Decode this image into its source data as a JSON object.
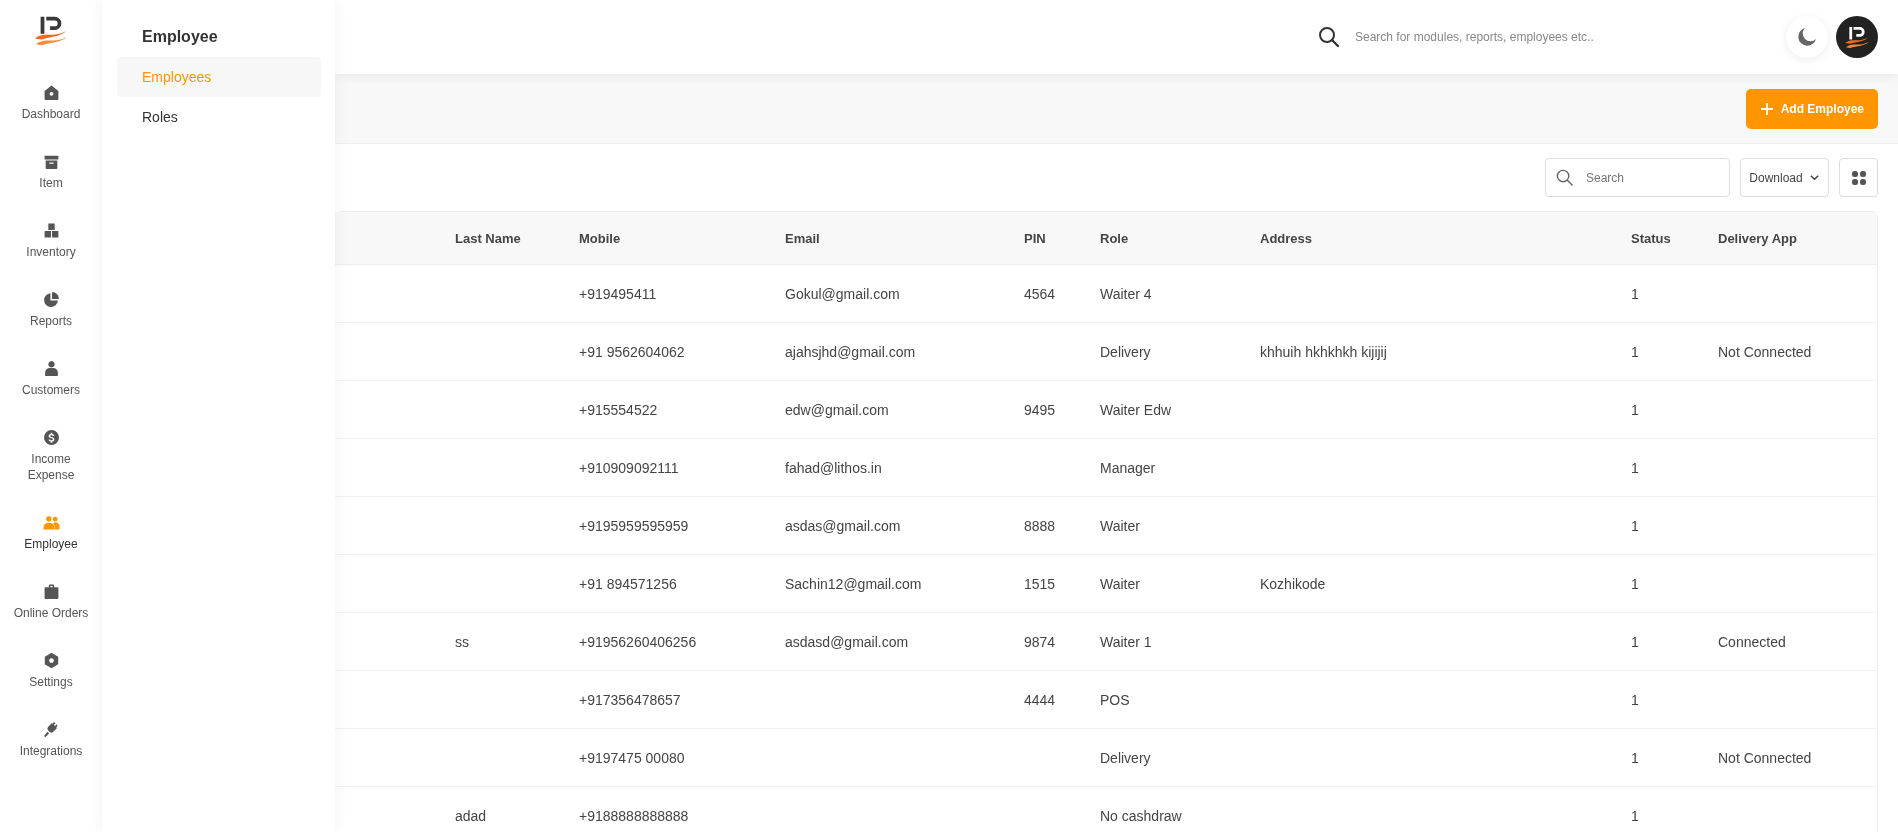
{
  "sidebar": {
    "items": [
      {
        "label": "Dashboard",
        "selected": false
      },
      {
        "label": "Item",
        "selected": false
      },
      {
        "label": "Inventory",
        "selected": false
      },
      {
        "label": "Reports",
        "selected": false
      },
      {
        "label": "Customers",
        "selected": false
      },
      {
        "label": "Income Expense",
        "selected": false
      },
      {
        "label": "Employee",
        "selected": true
      },
      {
        "label": "Online Orders",
        "selected": false
      },
      {
        "label": "Settings",
        "selected": false
      },
      {
        "label": "Integrations",
        "selected": false
      }
    ]
  },
  "submenu": {
    "title": "Employee",
    "items": [
      {
        "label": "Employees",
        "selected": true
      },
      {
        "label": "Roles",
        "selected": false
      }
    ]
  },
  "top_bar": {
    "search": {
      "placeholder": "Search for modules, reports, employees etc.."
    }
  },
  "header": {
    "add_button": "Add Employee"
  },
  "toolbar": {
    "search": {
      "placeholder": "Search"
    },
    "download": "Download"
  },
  "table": {
    "columns": [
      "Last Name",
      "Mobile",
      "Email",
      "PIN",
      "Role",
      "Address",
      "Status",
      "Delivery App"
    ],
    "rows": [
      {
        "mobile": "+919495411",
        "email": "Gokul@gmail.com",
        "pin": "4564",
        "role": "Waiter 4",
        "status": "1"
      },
      {
        "mobile": "+91 9562604062",
        "email": "ajahsjhd@gmail.com",
        "role": "Delivery",
        "address": "khhuih hkhkhkh kijijij",
        "status": "1",
        "delivery_app": "Not Connected"
      },
      {
        "mobile": "+915554522",
        "email": "edw@gmail.com",
        "pin": "9495",
        "role": "Waiter Edw",
        "status": "1"
      },
      {
        "mobile": "+910909092111",
        "email": "fahad@lithos.in",
        "role": "Manager",
        "status": "1"
      },
      {
        "mobile": "+9195959595959",
        "email": "asdas@gmail.com",
        "pin": "8888",
        "role": "Waiter",
        "status": "1"
      },
      {
        "mobile": "+91 894571256",
        "email": "Sachin12@gmail.com",
        "pin": "1515",
        "role": "Waiter",
        "address": "Kozhikode",
        "status": "1"
      },
      {
        "last_name": "ss",
        "mobile": "+91956260406256",
        "email": "asdasd@gmail.com",
        "pin": "9874",
        "role": "Waiter 1",
        "status": "1",
        "delivery_app": "Connected"
      },
      {
        "mobile": "+917356478657",
        "pin": "4444",
        "role": "POS",
        "status": "1"
      },
      {
        "mobile": "+9197475 00080",
        "role": "Delivery",
        "status": "1",
        "delivery_app": "Not Connected"
      },
      {
        "last_name": "adad",
        "mobile": "+9188888888888",
        "role": "No cashdraw",
        "status": "1"
      }
    ]
  }
}
